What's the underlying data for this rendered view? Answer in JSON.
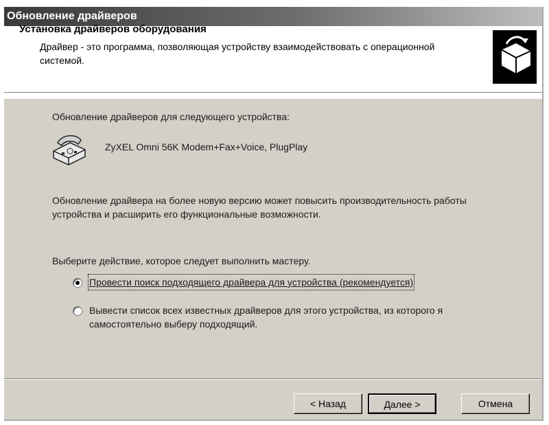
{
  "window": {
    "title": "Обновление драйверов"
  },
  "header": {
    "title": "Установка драйверов оборудования",
    "description": "Драйвер - это программа, позволяющая устройству взаимодействовать с операционной системой.",
    "icon": "hardware-install-icon"
  },
  "body": {
    "device_intro": "Обновление драйверов для следующего устройства:",
    "device_name": "ZyXEL Omni 56K Modem+Fax+Voice, PlugPlay",
    "device_icon": "modem-phone-icon",
    "info_text": "Обновление драйвера на более новую версию может повысить производительность работы устройства и расширить его функциональные возможности.",
    "action_prompt": "Выберите действие, которое следует выполнить мастеру."
  },
  "options": [
    {
      "label": "Провести поиск подходящего драйвера для устройства (рекомендуется)",
      "selected": true
    },
    {
      "label": "Вывести список всех известных драйверов для этого устройства, из которого я самостоятельно выберу подходящий.",
      "selected": false
    }
  ],
  "buttons": {
    "back": "< Назад",
    "next": "Далее >",
    "cancel": "Отмена"
  }
}
